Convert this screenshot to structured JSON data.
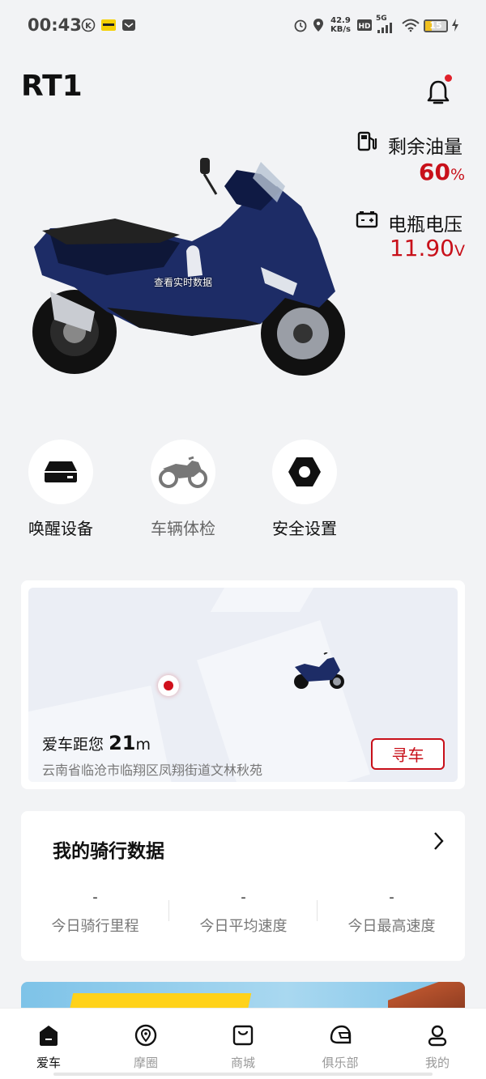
{
  "status_bar": {
    "time": "00:43",
    "net_speed_value": "42.9",
    "net_speed_unit": "KB/s",
    "network": "5G",
    "battery": "15"
  },
  "header": {
    "title": "RT1"
  },
  "vehicle": {
    "realtime_hint": "查看实时数据"
  },
  "stats": {
    "fuel_label": "剩余油量",
    "fuel_value": "60",
    "fuel_unit": "%",
    "voltage_label": "电瓶电压",
    "voltage_value": "11.90",
    "voltage_unit": "V"
  },
  "quick_actions": [
    {
      "label": "唤醒设备",
      "icon": "device-icon"
    },
    {
      "label": "车辆体检",
      "icon": "motorcycle-icon"
    },
    {
      "label": "安全设置",
      "icon": "hex-nut-icon"
    }
  ],
  "location": {
    "distance_prefix": "爱车距您",
    "distance_value": "21",
    "distance_unit": "m",
    "address": "云南省临沧市临翔区凤翔街道文林秋苑",
    "find_button": "寻车"
  },
  "ride": {
    "title": "我的骑行数据",
    "items": [
      {
        "value": "-",
        "label": "今日骑行里程"
      },
      {
        "value": "-",
        "label": "今日平均速度"
      },
      {
        "value": "-",
        "label": "今日最高速度"
      }
    ]
  },
  "nav": [
    {
      "label": "爱车",
      "active": true
    },
    {
      "label": "摩圈"
    },
    {
      "label": "商城"
    },
    {
      "label": "俱乐部"
    },
    {
      "label": "我的"
    }
  ],
  "colors": {
    "accent": "#c8101a",
    "background": "#f2f3f5"
  }
}
